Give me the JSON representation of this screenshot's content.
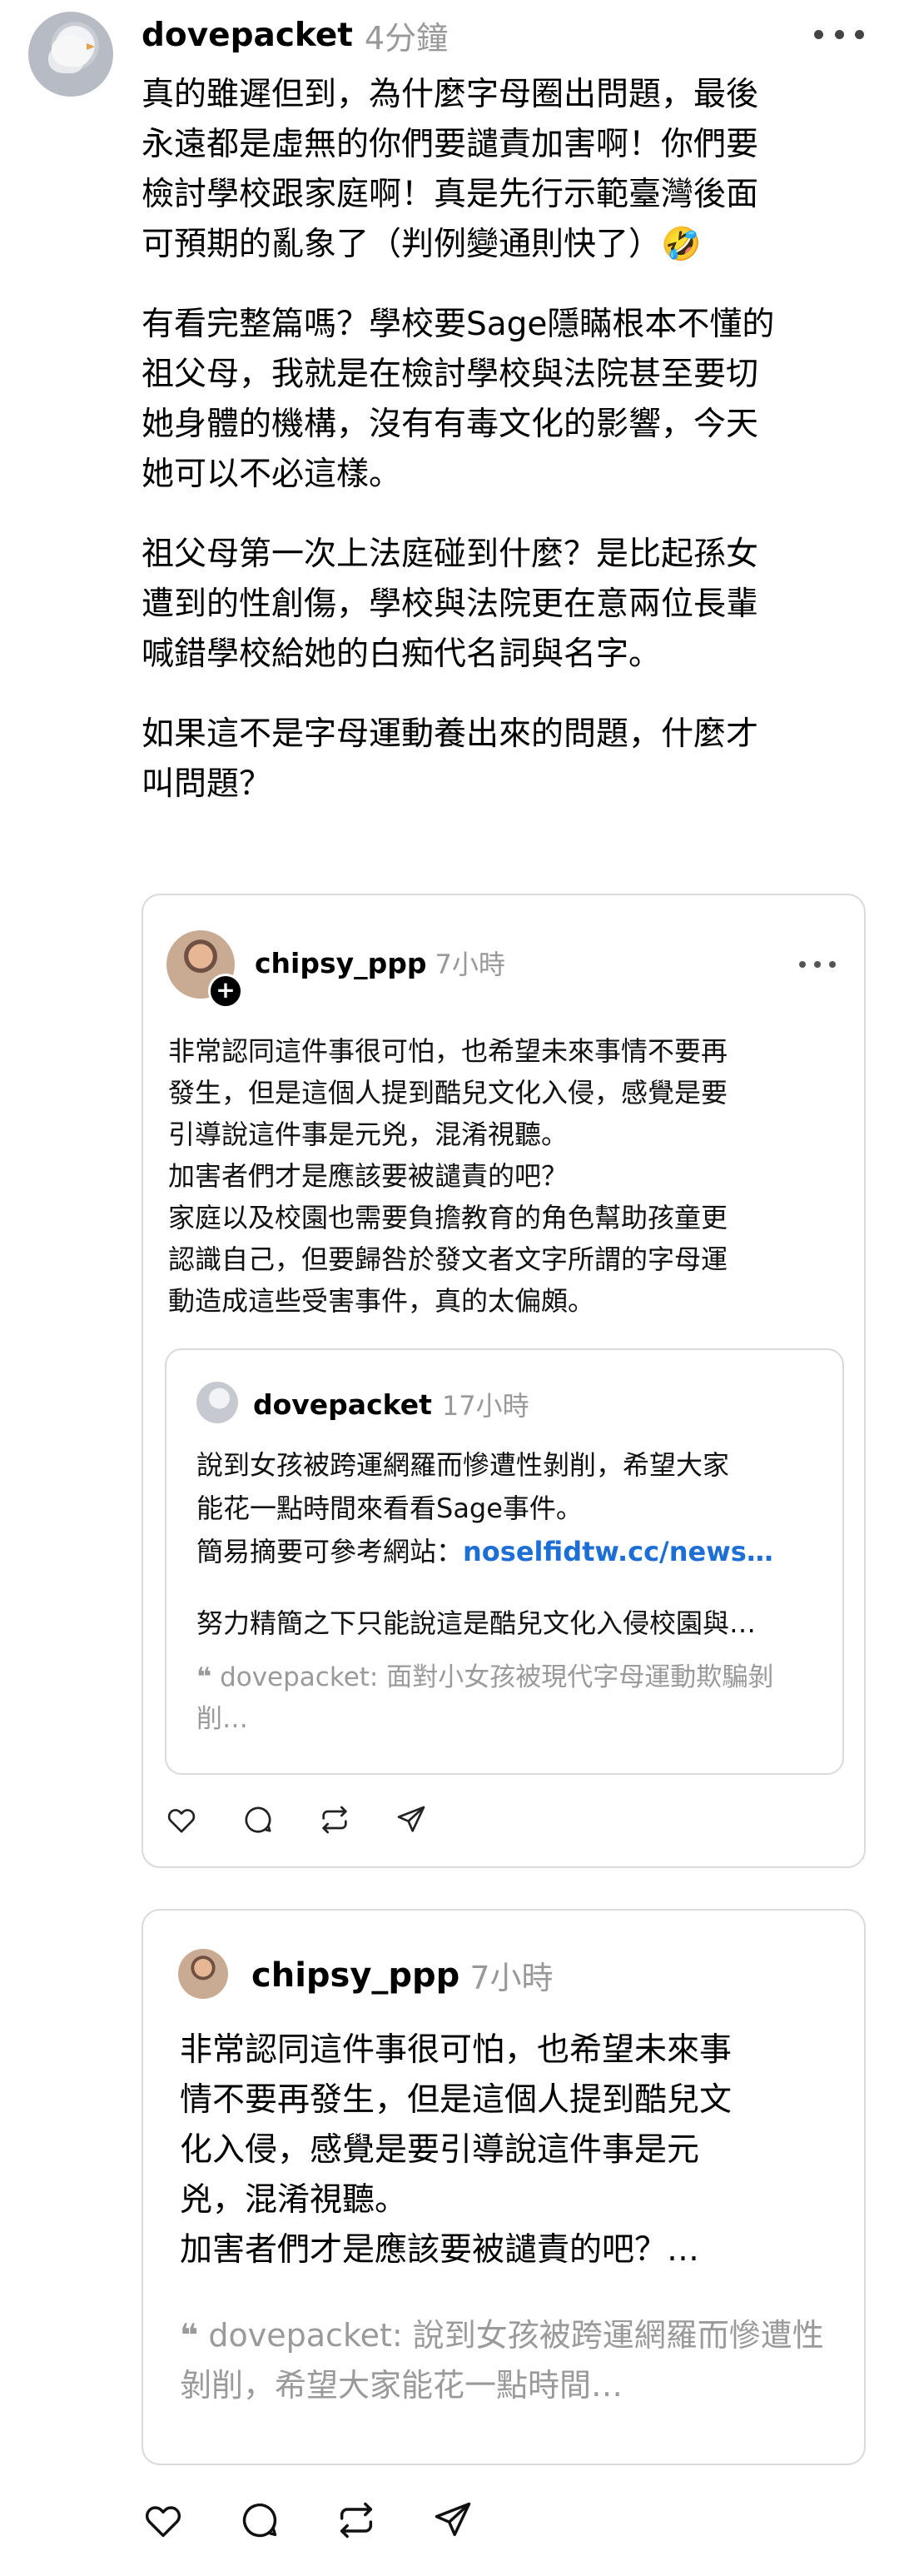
{
  "post": {
    "username": "dovepacket",
    "time": "4分鐘",
    "paragraphs": [
      "真的雖遲但到，為什麼字母圈出問題，最後\n永遠都是虛無的你們要譴責加害啊！你們要\n檢討學校跟家庭啊！真是先行示範臺灣後面\n可預期的亂象了（判例變通則快了）🤣",
      "有看完整篇嗎？學校要Sage隱瞞根本不懂的\n祖父母，我就是在檢討學校與法院甚至要切\n她身體的機構，沒有有毒文化的影響，今天\n她可以不必這樣。",
      "祖父母第一次上法庭碰到什麼？是比起孫女\n遭到的性創傷，學校與法院更在意兩位長輩\n喊錯學校給她的白痴代名詞與名字。",
      "如果這不是字母運動養出來的問題，什麼才\n叫問題？"
    ]
  },
  "quote_card": {
    "username": "chipsy_ppp",
    "time": "7小時",
    "body": "非常認同這件事很可怕，也希望未來事情不要再\n發生，但是這個人提到酷兒文化入侵，感覺是要\n引導說這件事是元兇，混淆視聽。\n加害者們才是應該要被譴責的吧？\n家庭以及校園也需要負擔教育的角色幫助孩童更\n認識自己，但要歸咎於發文者文字所謂的字母運\n動造成這些受害事件，真的太偏頗。",
    "nested": {
      "username": "dovepacket",
      "time": "17小時",
      "line1": "說到女孩被跨運網羅而慘遭性剝削，希望大家",
      "line2": "能花一點時間來看看Sage事件。",
      "line3_prefix": "簡易摘要可參考網站：",
      "link": "noselfidtw.cc/news…",
      "excerpt": "努力精簡之下只能說這是酷兒文化入侵校園與…",
      "quote_mark": "❝",
      "quote_text": "dovepacket: 面對小女孩被現代字母運動欺騙剝削…"
    }
  },
  "card2": {
    "username": "chipsy_ppp",
    "time": "7小時",
    "body": "非常認同這件事很可怕，也希望未來事\n情不要再發生，但是這個人提到酷兒文\n化入侵，感覺是要引導說這件事是元\n兇，混淆視聽。\n加害者們才是應該要被譴責的吧？…",
    "quote_mark": "❝",
    "quote_text": "dovepacket: 說到女孩被跨運網羅而慘遭性剝削，希望大家能花一點時間…"
  },
  "icons": {
    "like": "heart-icon",
    "reply": "comment-icon",
    "repost": "repost-icon",
    "share": "send-icon",
    "more": "more-icon"
  },
  "colors": {
    "link": "#1d6fd6",
    "muted": "#999999",
    "border": "#dadada"
  }
}
